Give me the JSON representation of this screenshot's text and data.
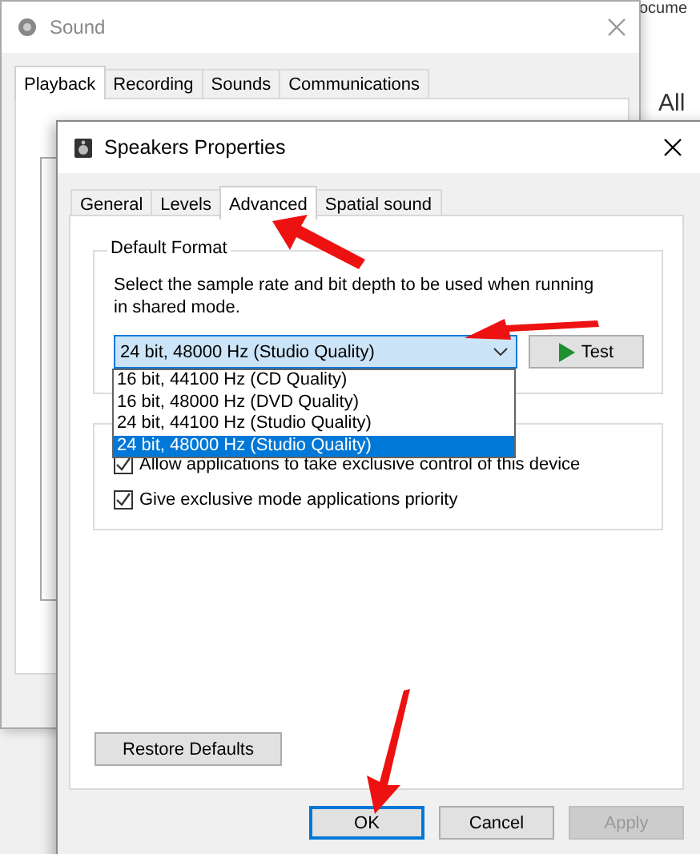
{
  "background_window": {
    "texts": [
      "ocume",
      "All"
    ]
  },
  "sound_window": {
    "title": "Sound",
    "tabs": [
      {
        "label": "Playback",
        "selected": true
      },
      {
        "label": "Recording",
        "selected": false
      },
      {
        "label": "Sounds",
        "selected": false
      },
      {
        "label": "Communications",
        "selected": false
      }
    ]
  },
  "dialog": {
    "title": "Speakers Properties",
    "tabs": [
      {
        "label": "General",
        "selected": false
      },
      {
        "label": "Levels",
        "selected": false
      },
      {
        "label": "Advanced",
        "selected": true
      },
      {
        "label": "Spatial sound",
        "selected": false
      }
    ],
    "default_format": {
      "label": "Default Format",
      "description": "Select the sample rate and bit depth to be used when running in shared mode.",
      "format_select": {
        "value": "24 bit, 48000 Hz (Studio Quality)",
        "expanded": true,
        "options": [
          {
            "label": "16 bit, 44100 Hz (CD Quality)",
            "selected": false
          },
          {
            "label": "16 bit, 48000 Hz (DVD Quality)",
            "selected": false
          },
          {
            "label": "24 bit, 44100 Hz (Studio Quality)",
            "selected": false
          },
          {
            "label": "24 bit, 48000 Hz (Studio Quality)",
            "selected": true
          }
        ]
      },
      "test_button": "Test"
    },
    "exclusive_mode": {
      "options": [
        {
          "label": "Allow applications to take exclusive control of this device",
          "checked": true
        },
        {
          "label": "Give exclusive mode applications priority",
          "checked": true
        }
      ]
    },
    "restore_button": "Restore Defaults",
    "buttons": [
      {
        "label": "OK",
        "focused": true,
        "disabled": false
      },
      {
        "label": "Cancel",
        "focused": false,
        "disabled": false
      },
      {
        "label": "Apply",
        "focused": false,
        "disabled": true
      }
    ]
  }
}
